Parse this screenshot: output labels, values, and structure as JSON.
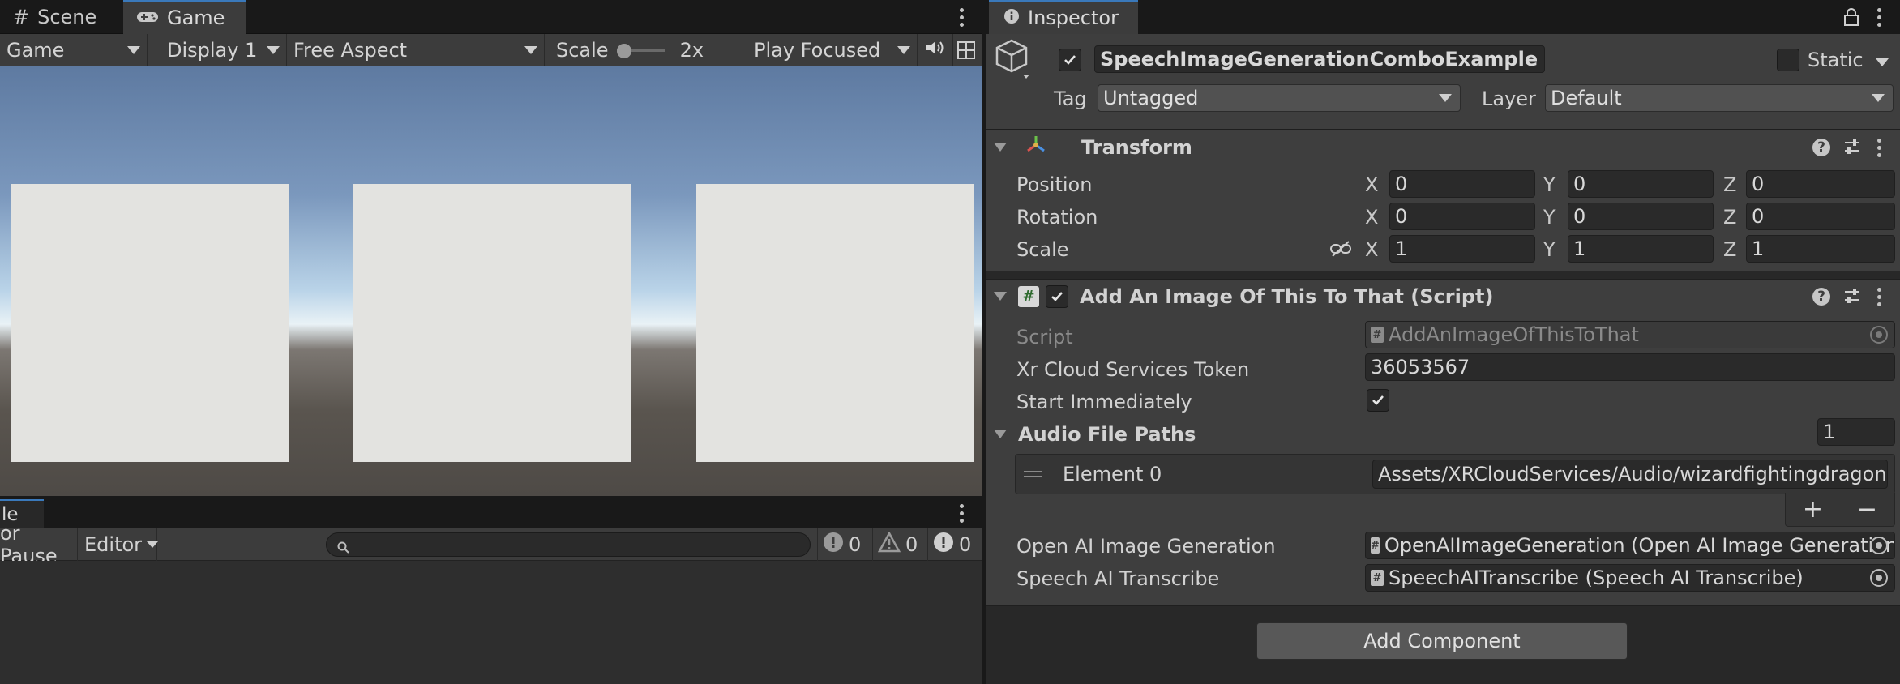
{
  "game_window": {
    "tabs": [
      {
        "label": "Scene",
        "icon": "hash-icon"
      },
      {
        "label": "Game",
        "icon": "gamepad-icon"
      }
    ],
    "toolbar": {
      "display_mode": "Game",
      "display": "Display 1",
      "aspect": "Free Aspect",
      "scale_label": "Scale",
      "scale_value": "2x",
      "play_mode": "Play Focused"
    }
  },
  "console_window": {
    "tab_label": "le",
    "pause_label": "or Pause",
    "editor_label": "Editor",
    "search_placeholder": "",
    "counts": {
      "logs": "0",
      "warnings": "0",
      "errors": "0"
    }
  },
  "inspector": {
    "tab_label": "Inspector",
    "object": {
      "active": true,
      "name": "SpeechImageGenerationComboExample",
      "static_label": "Static",
      "tag_label": "Tag",
      "tag_value": "Untagged",
      "layer_label": "Layer",
      "layer_value": "Default"
    },
    "transform": {
      "title": "Transform",
      "rows": [
        {
          "label": "Position",
          "x": "0",
          "y": "0",
          "z": "0"
        },
        {
          "label": "Rotation",
          "x": "0",
          "y": "0",
          "z": "0"
        },
        {
          "label": "Scale",
          "x": "1",
          "y": "1",
          "z": "1"
        }
      ],
      "axes": [
        "X",
        "Y",
        "Z"
      ]
    },
    "script_component": {
      "title": "Add An Image Of This To That (Script)",
      "enabled": true,
      "script_label": "Script",
      "script_value": "AddAnImageOfThisToThat",
      "token_label": "Xr Cloud Services Token",
      "token_value": "36053567",
      "start_label": "Start Immediately",
      "start_checked": true,
      "audio_paths_label": "Audio File Paths",
      "audio_paths_count": "1",
      "elements": [
        {
          "label": "Element 0",
          "value": "Assets/XRCloudServices/Audio/wizardfightingdragon.m"
        }
      ],
      "add_symbol": "+",
      "remove_symbol": "−",
      "image_gen_label": "Open AI Image Generation",
      "image_gen_value": "OpenAIImageGeneration (Open AI Image Generation",
      "transcribe_label": "Speech AI Transcribe",
      "transcribe_value": "SpeechAITranscribe (Speech AI Transcribe)"
    },
    "add_component_label": "Add Component"
  },
  "colors": {
    "accent": "#3a79bb",
    "panel": "#282828",
    "header": "#3e3e3e"
  }
}
